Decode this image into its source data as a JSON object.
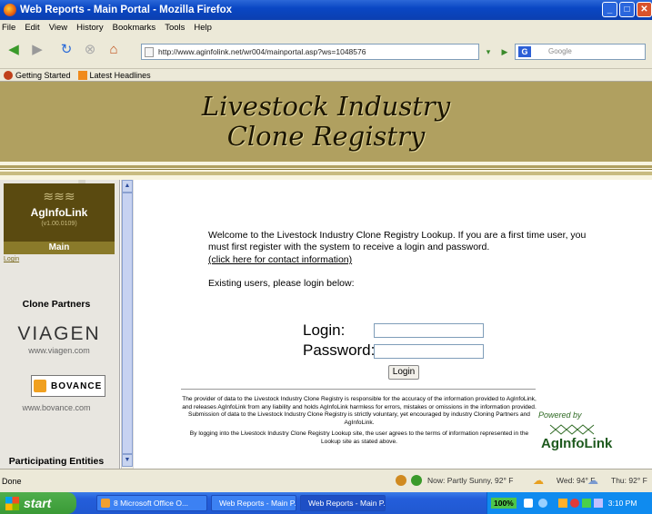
{
  "window": {
    "title": "Web Reports - Main Portal - Mozilla Firefox"
  },
  "menu": [
    "File",
    "Edit",
    "View",
    "History",
    "Bookmarks",
    "Tools",
    "Help"
  ],
  "nav": {
    "url": "http://www.aginfolink.net/wr004/mainportal.asp?ws=1048576",
    "search_placeholder": "Google"
  },
  "bookmarks": [
    {
      "label": "Getting Started"
    },
    {
      "label": "Latest Headlines"
    }
  ],
  "banner": {
    "line1": "Livestock Industry",
    "line2": "Clone Registry"
  },
  "sidebar": {
    "logo_name": "AgInfoLink",
    "version": "(v1.00.0109)",
    "main_label": "Main",
    "login_link": "Login",
    "clone_partners": "Clone Partners",
    "viagen": "VIAGEN",
    "viagen_url": "www.viagen.com",
    "bovance": "BOVANCE",
    "bovance_url": "www.bovance.com",
    "participating": "Participating Entities"
  },
  "content": {
    "welcome": "Welcome to the Livestock Industry Clone Registry Lookup.  If you are a first time user, you must first register with the system to receive a login and password.",
    "contact_link": "(click here for contact information)",
    "existing": "Existing users, please login below:",
    "login_label": "Login:",
    "password_label": "Password:",
    "login_button": "Login",
    "disclaimer1": "The provider of data to the Livestock Industry Clone Registry is responsible for the accuracy of the information provided to AgInfoLink, and releases AgInfoLink from any liability and holds AgInfoLink harmless for errors, mistakes or omissions in the information provided. Submission of data to the Livestock Industry Clone Registry is strictly voluntary, yet encouraged by industry Cloning Partners and AgInfoLink.",
    "disclaimer2": "By logging into the Livestock Industry Clone Registry Lookup site, the user agrees to the terms of information represented in the Lookup site as stated above.",
    "powered_by": "Powered by",
    "powered_logo": "AgInfoLink"
  },
  "status": {
    "done": "Done",
    "weather_now": "Now: Partly Sunny, 92° F",
    "weather_wed": "Wed: 94° F",
    "weather_thu": "Thu: 92° F"
  },
  "taskbar": {
    "start": "start",
    "tasks": [
      "8 Microsoft Office O...",
      "Web Reports - Main P...",
      "Web Reports - Main P..."
    ],
    "battery": "100%",
    "time": "3:10 PM"
  }
}
